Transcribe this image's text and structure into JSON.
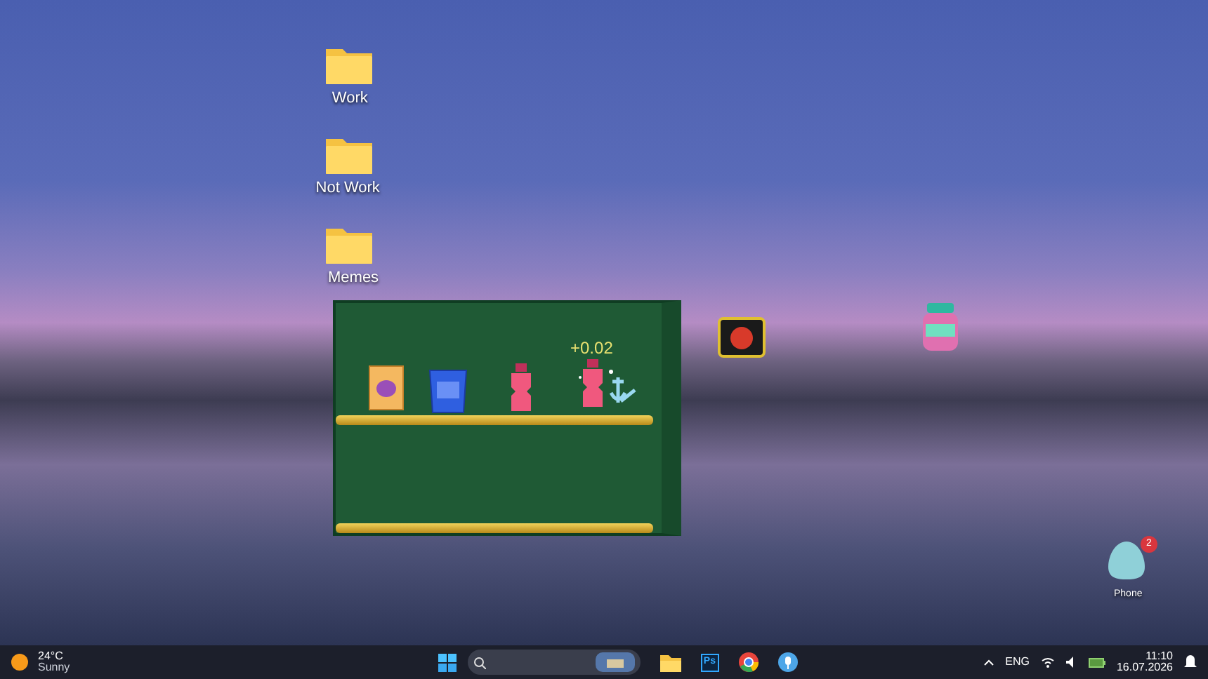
{
  "desktop_icons": [
    {
      "label": "Work"
    },
    {
      "label": "Not Work"
    },
    {
      "label": "Memes"
    }
  ],
  "shelf": {
    "items": [
      {
        "kind": "cereal",
        "highlighted": false
      },
      {
        "kind": "chips",
        "highlighted": false
      },
      {
        "kind": "bottle",
        "highlighted": false
      },
      {
        "kind": "bottle",
        "highlighted": true
      }
    ],
    "floating_text": "+0.02"
  },
  "loose_items": [
    {
      "kind": "can"
    },
    {
      "kind": "jar"
    }
  ],
  "phone": {
    "label": "Phone",
    "badge": "2"
  },
  "taskbar": {
    "weather": {
      "temp": "24°C",
      "condition": "Sunny"
    },
    "apps": [
      {
        "kind": "files"
      },
      {
        "kind": "photoshop",
        "text": "Ps"
      },
      {
        "kind": "chrome"
      },
      {
        "kind": "mic"
      }
    ],
    "language": "ENG",
    "time": "11:10",
    "date": "16.07.2026"
  }
}
